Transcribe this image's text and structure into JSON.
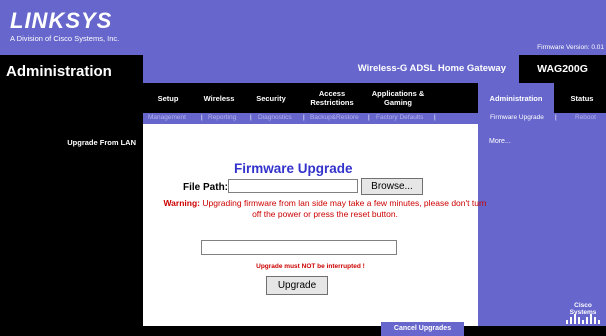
{
  "header": {
    "logo": "LINKSYS",
    "logo_subtitle": "A Division of Cisco Systems, Inc.",
    "firmware_version": "Firmware Version: 0.01"
  },
  "page": {
    "title": "Administration",
    "product_name": "Wireless-G ADSL Home Gateway",
    "model": "WAG200G"
  },
  "nav": {
    "items": [
      {
        "label": "Setup"
      },
      {
        "label": "Wireless"
      },
      {
        "label": "Security"
      },
      {
        "label": "Access Restrictions"
      },
      {
        "label": "Applications & Gaming"
      },
      {
        "label": "Administration"
      },
      {
        "label": "Status"
      }
    ],
    "active": "Administration"
  },
  "subnav": {
    "items": [
      {
        "label": "Management"
      },
      {
        "label": "Reporting"
      },
      {
        "label": "Diagnostics"
      },
      {
        "label": "Backup&Restore"
      },
      {
        "label": "Factory Defaults"
      },
      {
        "label": "Firmware Upgrade"
      },
      {
        "label": "Reboot"
      }
    ],
    "separator": "|",
    "active": "Firmware Upgrade"
  },
  "section": {
    "label": "Upgrade From LAN",
    "more_link": "More..."
  },
  "form": {
    "title": "Firmware Upgrade",
    "file_path_label": "File Path:",
    "file_path_value": "",
    "browse_label": "Browse...",
    "warning_prefix": "Warning:",
    "warning_text": "Upgrading firmware from lan side may take a few minutes, please don't turn off the power or press the reset button.",
    "progress_value": 0,
    "interrupt_text": "Upgrade must NOT be interrupted !",
    "upgrade_label": "Upgrade"
  },
  "footer": {
    "cancel_label": "Cancel Upgrades",
    "cisco_text": "Cisco Systems"
  },
  "colors": {
    "brand_purple": "#6666cc",
    "title_blue": "#3333cc",
    "warning_red": "#cc0000"
  }
}
